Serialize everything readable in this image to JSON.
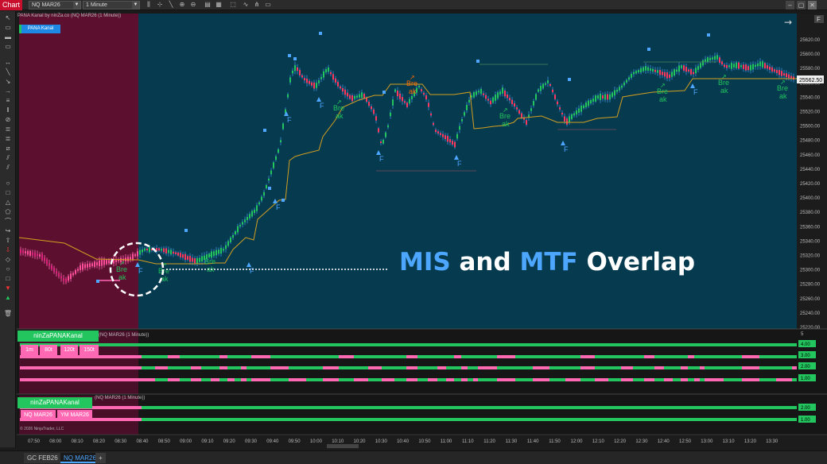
{
  "toolbar": {
    "chart_label": "Chart",
    "instrument": "NQ MAR26",
    "timeframe": "1 Minute"
  },
  "panel_indicator_label": "PANA Kanal",
  "chart_title": "PANA Kanal by ninZa.co (NQ MAR26 (1 Minute))",
  "overlay": {
    "part1": "MIS",
    "part2": "and",
    "part3": "MTF",
    "part4": "Overlap"
  },
  "signals": {
    "break_line1": "Bre",
    "break_line2": "ak",
    "f_label": "F",
    "break_orange_line1": "Bre",
    "break_orange_line2": "ak"
  },
  "price_axis": {
    "labels": [
      "25620.00",
      "25600.00",
      "25580.00",
      "25560.00",
      "25540.00",
      "25520.00",
      "25500.00",
      "25480.00",
      "25460.00",
      "25440.00",
      "25420.00",
      "25400.00",
      "25380.00",
      "25360.00",
      "25340.00",
      "25320.00",
      "25300.00",
      "25280.00",
      "25260.00",
      "25240.00",
      "25220.00"
    ],
    "current_price": "25562.50",
    "f_marker": "F"
  },
  "time_axis": {
    "labels": [
      "07:50",
      "08:00",
      "08:10",
      "08:20",
      "08:30",
      "08:40",
      "08:50",
      "09:00",
      "09:10",
      "09:20",
      "09:30",
      "09:40",
      "09:50",
      "10:00",
      "10:10",
      "10:20",
      "10:30",
      "10:40",
      "10:50",
      "11:00",
      "11:10",
      "11:20",
      "11:30",
      "11:40",
      "11:50",
      "12:00",
      "12:10",
      "12:20",
      "12:30",
      "12:40",
      "12:50",
      "13:00",
      "13:10",
      "13:20",
      "13:30"
    ]
  },
  "indicator_panel1": {
    "header": "ninZaPANAKanal",
    "subtitle": "ninZaPANAKanal (NQ MAR26 (1 Minute))",
    "timeframes": [
      "1m",
      "80t",
      "120t",
      "150t"
    ],
    "axis_labels": [
      "5",
      "4.00",
      "3.00",
      "2.00",
      "1.00"
    ]
  },
  "indicator_panel2": {
    "header": "ninZaPANAKanal",
    "subtitle": "(NQ MAR26 (1 Minute))",
    "instruments": [
      "NQ MAR26",
      "YM MAR26"
    ],
    "axis_labels": [
      "2.00",
      "1.00"
    ],
    "copyright": "© 2026 NinjaTrader, LLC"
  },
  "bottom_tabs": {
    "tab1": "GC FEB26",
    "tab2": "NQ MAR26",
    "add": "+"
  },
  "colors": {
    "bg_teal": "#063a4f",
    "bg_maroon": "#5c0f2e",
    "bull": "#22c55e",
    "bear": "#ff3860",
    "wick_blue": "#3b8fd9",
    "channel": "#d4a020",
    "signal_blue": "#4da6ff",
    "pink": "#ff69b4"
  }
}
